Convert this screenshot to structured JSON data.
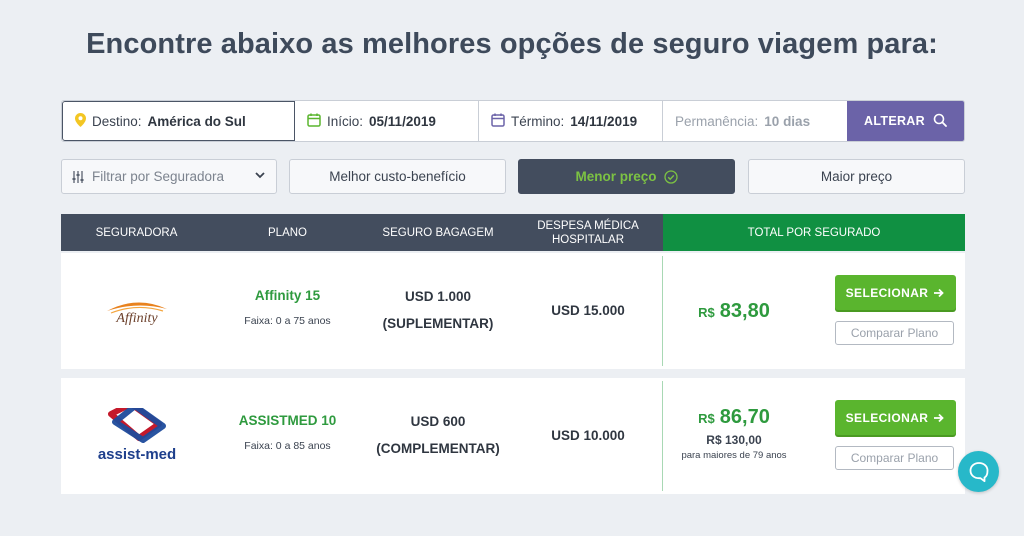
{
  "headline": "Encontre abaixo as melhores opções de seguro viagem para:",
  "search": {
    "destination_label": "Destino:",
    "destination_value": "América do Sul",
    "start_label": "Início:",
    "start_value": "05/11/2019",
    "end_label": "Término:",
    "end_value": "14/11/2019",
    "stay_label": "Permanência:",
    "stay_value": "10 dias",
    "change_button": "ALTERAR"
  },
  "filters": {
    "insurer_select": "Filtrar por Seguradora",
    "best_value": "Melhor custo-benefício",
    "lowest_price": "Menor preço",
    "highest_price": "Maior preço"
  },
  "table": {
    "headers": [
      "SEGURADORA",
      "PLANO",
      "SEGURO BAGAGEM",
      "DESPESA MÉDICA HOSPITALAR",
      "TOTAL POR SEGURADO"
    ],
    "rows": [
      {
        "insurer": "Affinity",
        "plan": "Affinity 15",
        "range": "Faixa: 0 a 75 anos",
        "baggage_amount": "USD 1.000",
        "baggage_type": "(SUPLEMENTAR)",
        "medical": "USD 15.000",
        "currency": "R$",
        "price": "83,80",
        "select_label": "SELECIONAR",
        "compare_label": "Comparar Plano"
      },
      {
        "insurer": "assist-med",
        "plan": "ASSISTMED 10",
        "range": "Faixa: 0 a 85 anos",
        "baggage_amount": "USD 600",
        "baggage_type": "(COMPLEMENTAR)",
        "medical": "USD 10.000",
        "currency": "R$",
        "price": "86,70",
        "older_price": "R$ 130,00",
        "older_note": "para maiores de 79 anos",
        "select_label": "SELECIONAR",
        "compare_label": "Comparar Plano"
      }
    ]
  },
  "colors": {
    "accent_purple": "#6b63a8",
    "header_dark": "#434d5e",
    "total_green": "#109042",
    "button_green": "#5ab52e",
    "price_green": "#2e9a3e",
    "chat_teal": "#27b8c9"
  }
}
